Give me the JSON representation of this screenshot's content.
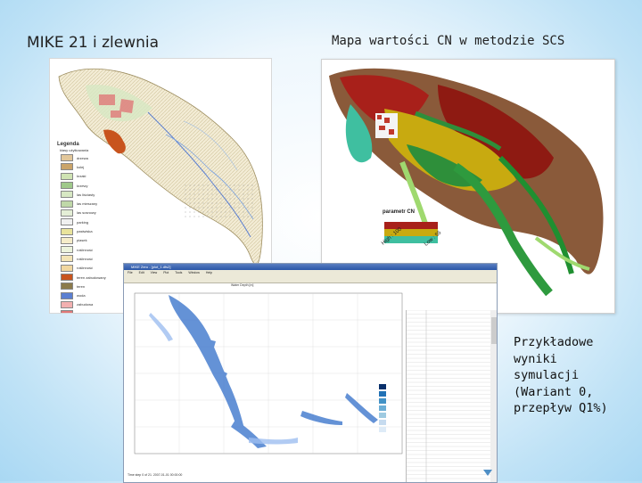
{
  "slide": {
    "title_left": "MIKE 21 i zlewnia",
    "title_right": "Mapa wartości CN w metodzie SCS",
    "caption_lines": [
      "Przykładowe",
      "wyniki",
      "symulacji",
      "(Wariant 0,",
      "przepływ Q1%)"
    ]
  },
  "land_map": {
    "legend_title": "Legenda",
    "legend_subtitle": "klasy użytkowania",
    "legend_items": [
      {
        "label": "drzewa",
        "color": "#e2c79a"
      },
      {
        "label": "kolej",
        "color": "#caa46a"
      },
      {
        "label": "krzaki",
        "color": "#cfe3b3"
      },
      {
        "label": "krzewy",
        "color": "#9fc98a"
      },
      {
        "label": "las liściasty",
        "color": "#d7e8c3"
      },
      {
        "label": "las mieszany",
        "color": "#bfd8a8"
      },
      {
        "label": "las sosnowy",
        "color": "#e4eed6"
      },
      {
        "label": "parking",
        "color": "#f0f0f0"
      },
      {
        "label": "pastwiska",
        "color": "#e9e39c"
      },
      {
        "label": "piasek",
        "color": "#f5ecc9"
      },
      {
        "label": "roślinność",
        "color": "#ecf3dc"
      },
      {
        "label": "roślinność",
        "color": "#f3e4b6"
      },
      {
        "label": "roślinność",
        "color": "#f1d7a0"
      },
      {
        "label": "teren zabudowany",
        "color": "#c8541e"
      },
      {
        "label": "teren",
        "color": "#8b7a4b"
      },
      {
        "label": "woda",
        "color": "#5b7fd1"
      },
      {
        "label": "zabudowa",
        "color": "#f2b0b0"
      },
      {
        "label": "zabudowa zwarta",
        "color": "#e07878"
      },
      {
        "label": "łąki",
        "color": "#d9ecc7"
      }
    ]
  },
  "cn_map": {
    "legend_title": "parametr CN",
    "high_label": "High : 100",
    "low_label": "Low : 55"
  },
  "sim_window": {
    "title": "MIKE Zero - [plot_1.dfs2]",
    "menu": [
      "File",
      "Edit",
      "View",
      "Plot",
      "Tools",
      "Window",
      "Help"
    ],
    "inner_title": "Water Depth [m]",
    "status": "Time step 0 of 21. 2007-01-01 00:00:00"
  }
}
